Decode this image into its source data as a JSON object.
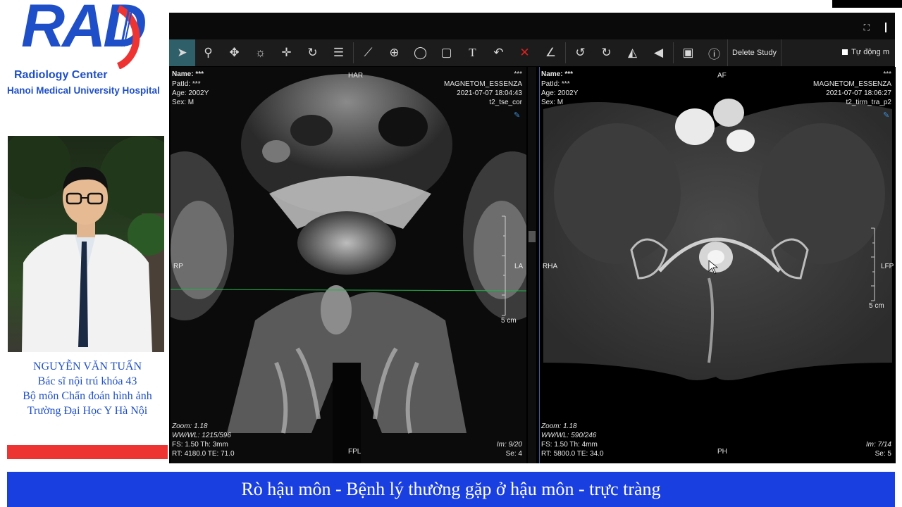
{
  "logo": {
    "text": "RAD",
    "line1": "Radiology Center",
    "line2": "Hanoi Medical University Hospital"
  },
  "presenter": {
    "name": "NGUYỄN VĂN TUẤN",
    "title": "Bác sĩ nội trú khóa 43",
    "department": "Bộ môn Chẩn đoán hình ảnh",
    "school": "Trường Đại Học Y Hà Nội"
  },
  "toolbar": {
    "tools": [
      "pointer-icon",
      "zoom-icon",
      "pan-icon",
      "window-level-icon",
      "crosshair-icon",
      "rotate-icon",
      "stack-scroll-icon",
      "length-icon",
      "probe-icon",
      "ellipse-icon",
      "rectangle-icon",
      "text-icon",
      "undo-icon",
      "delete-annotation-icon",
      "angle-icon",
      "rotate-left-icon",
      "rotate-right-icon",
      "flip-horizontal-icon",
      "flip-vertical-icon",
      "save-icon",
      "info-icon"
    ],
    "delete_study": "Delete Study",
    "auto_label": "Tự động m"
  },
  "viewport1": {
    "name": "Name: ***",
    "patid": "PatId: ***",
    "age": "Age: 2002Y",
    "sex": "Sex: M",
    "orient_top": "HAR",
    "orient_left": "RP",
    "orient_right": "LA",
    "orient_bottom": "FPL",
    "top_right_star": "***",
    "scanner": "MAGNETOM_ESSENZA",
    "datetime": "2021-07-07  18:04:43",
    "series_desc": "t2_tse_cor",
    "zoom": "Zoom: 1.18",
    "wwwl": "WW/WL: 1215/596",
    "fs": "FS: 1.50  Th: 3mm",
    "rt": "RT: 4180.0  TE: 71.0",
    "im": "Im: 9/20",
    "se": "Se: 4",
    "scale": "5 cm"
  },
  "viewport2": {
    "name": "Name: ***",
    "patid": "PatId: ***",
    "age": "Age: 2002Y",
    "sex": "Sex: M",
    "orient_top": "AF",
    "orient_left": "RHA",
    "orient_right": "LFP",
    "orient_bottom": "PH",
    "top_right_star": "***",
    "scanner": "MAGNETOM_ESSENZA",
    "datetime": "2021-07-07  18:06:27",
    "series_desc": "t2_tirm_tra_p2",
    "zoom": "Zoom: 1.18",
    "wwwl": "WW/WL: 590/246",
    "fs": "FS: 1.50  Th: 4mm",
    "rt": "RT: 5800.0  TE: 34.0",
    "im": "Im: 7/14",
    "se": "Se: 5",
    "scale": "5 cm"
  },
  "bottom_title": "Rò hậu môn - Bệnh lý thường gặp ở hậu môn - trực tràng",
  "colors": {
    "brand_blue": "#1f4fc8",
    "banner_blue": "#1a3fe0",
    "accent_red": "#ee3333",
    "toolbar_bg": "#1c1c1c",
    "active_tool": "#2f5f68",
    "reference_line": "#21b24a"
  }
}
